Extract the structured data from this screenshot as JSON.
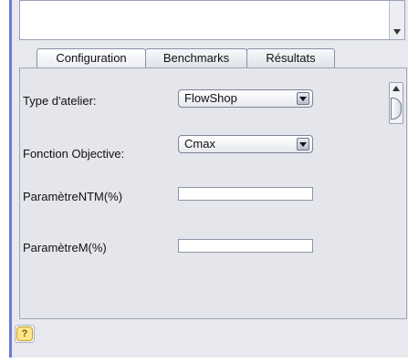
{
  "tabs": [
    {
      "label": "Configuration",
      "active": true
    },
    {
      "label": "Benchmarks",
      "active": false
    },
    {
      "label": "Résultats",
      "active": false
    }
  ],
  "config": {
    "workshop_type_label": "Type d'atelier:",
    "workshop_type_value": "FlowShop",
    "objective_label": "Fonction Objective:",
    "objective_value": "Cmax",
    "param_ntm_label": "ParamètreNTM(%)",
    "param_ntm_value": "",
    "param_m_label": "ParamètreM(%)",
    "param_m_value": ""
  },
  "help": {
    "glyph": "?"
  },
  "colors": {
    "accent": "#6b7bd0",
    "panel": "#e4e6ec",
    "help": "#fde58a"
  }
}
